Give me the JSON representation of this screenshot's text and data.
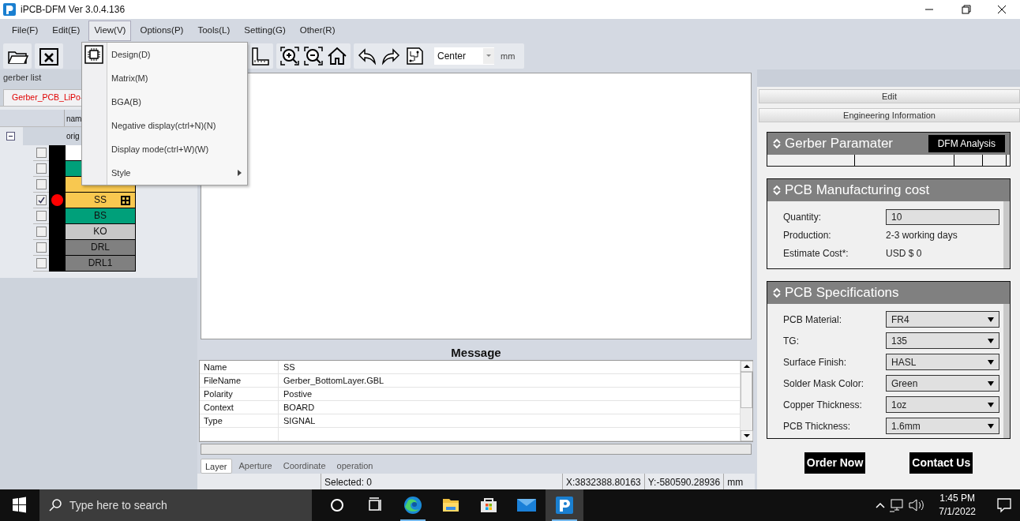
{
  "window": {
    "title": "iPCB-DFM Ver 3.0.4.136"
  },
  "menu_bar": [
    {
      "label": "File(F)",
      "selected": false
    },
    {
      "label": "Edit(E)",
      "selected": false
    },
    {
      "label": "View(V)",
      "selected": true
    },
    {
      "label": "Options(P)",
      "selected": false
    },
    {
      "label": "Tools(L)",
      "selected": false
    },
    {
      "label": "Setting(G)",
      "selected": false
    },
    {
      "label": "Other(R)",
      "selected": false
    }
  ],
  "view_menu": [
    {
      "label": "Design(D)",
      "kind": "icon"
    },
    {
      "label": "Matrix(M)",
      "kind": "plain"
    },
    {
      "label": "BGA(B)",
      "kind": "plain"
    },
    {
      "label": "Negative display(ctrl+N)(N)",
      "kind": "plain"
    },
    {
      "label": "Display mode(ctrl+W)(W)",
      "kind": "plain"
    },
    {
      "label": "Style",
      "kind": "submenu"
    }
  ],
  "toolbar": {
    "position": "Center",
    "unit": "mm"
  },
  "gerber_list": {
    "title": "gerber list",
    "tab": "Gerber_PCB_LiPo-",
    "column_1": "nam",
    "group": "orig",
    "expanded": true,
    "layers": [
      {
        "checked": false,
        "color": "#ffffff",
        "current": false
      },
      {
        "checked": false,
        "color": "#00a07a",
        "current": false
      },
      {
        "checked": false,
        "color": "#f8c850",
        "current": false
      },
      {
        "name": "SS",
        "checked": true,
        "color": "#f8c850",
        "current": true
      },
      {
        "name": "BS",
        "checked": false,
        "color": "#00a07a",
        "current": false
      },
      {
        "name": "KO",
        "checked": false,
        "color": "#c8c8c8",
        "current": false
      },
      {
        "name": "DRL",
        "checked": false,
        "color": "#808080",
        "current": false
      },
      {
        "name": "DRL1",
        "checked": false,
        "color": "#808080",
        "current": false
      }
    ]
  },
  "message": {
    "title": "Message",
    "rows": [
      {
        "key": "Name",
        "value": "SS"
      },
      {
        "key": "FileName",
        "value": "Gerber_BottomLayer.GBL"
      },
      {
        "key": "Polarity",
        "value": "Postive"
      },
      {
        "key": "Context",
        "value": "BOARD"
      },
      {
        "key": "Type",
        "value": "SIGNAL"
      }
    ],
    "tabs": [
      {
        "label": "Layer",
        "selected": true
      },
      {
        "label": "Aperture",
        "selected": false
      },
      {
        "label": "Coordinate",
        "selected": false
      },
      {
        "label": "operation",
        "selected": false
      }
    ]
  },
  "status_bar": {
    "selected": "Selected: 0",
    "x": "X:3832388.80163",
    "y": "Y:-580590.28936",
    "unit": "mm"
  },
  "right_panel": {
    "edit_title": "Edit",
    "info_title": "Engineering Information",
    "gerber": {
      "title": "Gerber Paramater",
      "button": "DFM Analysis"
    },
    "cost": {
      "title": "PCB Manufacturing cost",
      "rows": [
        {
          "label": "Quantity:",
          "value": "10",
          "kind": "input"
        },
        {
          "label": "Production:",
          "value": "2-3 working days",
          "kind": "text"
        },
        {
          "label": "Estimate Cost*:",
          "value": "USD $ 0",
          "kind": "text"
        }
      ]
    },
    "specs": {
      "title": "PCB Specifications",
      "rows": [
        {
          "label": "PCB Material:",
          "value": "FR4"
        },
        {
          "label": "TG:",
          "value": "135"
        },
        {
          "label": "Surface Finish:",
          "value": "HASL"
        },
        {
          "label": "Solder Mask Color:",
          "value": "Green"
        },
        {
          "label": "Copper Thickness:",
          "value": "1oz"
        },
        {
          "label": "PCB Thickness:",
          "value": "1.6mm"
        }
      ]
    },
    "buttons": [
      "Order Now",
      "Contact Us"
    ]
  },
  "taskbar": {
    "search": {
      "placeholder": "Type here to search"
    },
    "time": "1:45 PM",
    "date": "7/1/2022",
    "apps": [
      {
        "kind": "cortana",
        "running": false,
        "selected": false
      },
      {
        "kind": "taskview",
        "running": false,
        "selected": false
      },
      {
        "kind": "edge",
        "running": true,
        "selected": false
      },
      {
        "kind": "explorer",
        "running": false,
        "selected": false
      },
      {
        "kind": "store",
        "running": false,
        "selected": false
      },
      {
        "kind": "mail",
        "running": false,
        "selected": false
      },
      {
        "kind": "ipcb",
        "running": true,
        "selected": true
      }
    ]
  }
}
